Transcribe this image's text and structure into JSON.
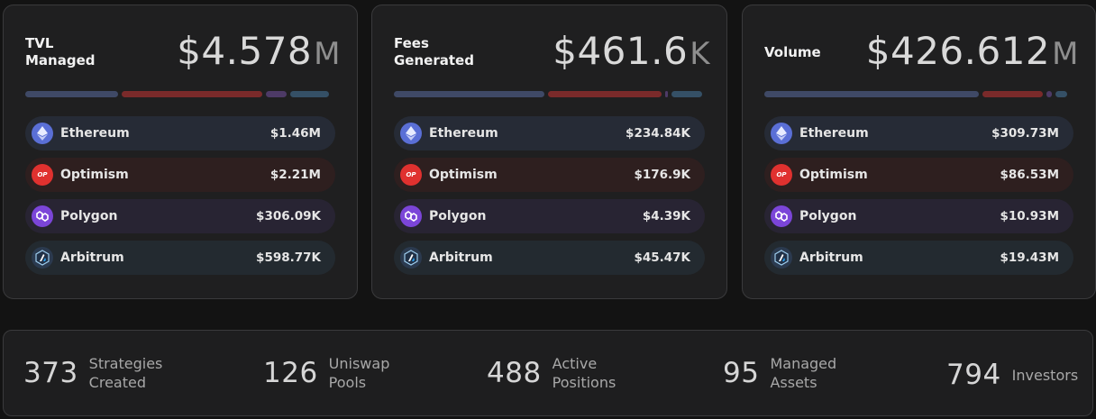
{
  "cards": [
    {
      "title": "TVL\nManaged",
      "value": "$4.578",
      "unit": "M",
      "bar": [
        {
          "color": "#3f4966",
          "share": 0.31
        },
        {
          "color": "#7a2a2a",
          "share": 0.47
        },
        {
          "color": "#4d3a66",
          "share": 0.07
        },
        {
          "color": "#355066",
          "share": 0.13
        }
      ],
      "rows": [
        {
          "chain": "Ethereum",
          "value": "$1.46M"
        },
        {
          "chain": "Optimism",
          "value": "$2.21M"
        },
        {
          "chain": "Polygon",
          "value": "$306.09K"
        },
        {
          "chain": "Arbitrum",
          "value": "$598.77K"
        }
      ]
    },
    {
      "title": "Fees\nGenerated",
      "value": "$461.6",
      "unit": "K",
      "bar": [
        {
          "color": "#3f4966",
          "share": 0.5
        },
        {
          "color": "#7a2a2a",
          "share": 0.38
        },
        {
          "color": "#4d3a66",
          "share": 0.01
        },
        {
          "color": "#355066",
          "share": 0.1
        }
      ],
      "rows": [
        {
          "chain": "Ethereum",
          "value": "$234.84K"
        },
        {
          "chain": "Optimism",
          "value": "$176.9K"
        },
        {
          "chain": "Polygon",
          "value": "$4.39K"
        },
        {
          "chain": "Arbitrum",
          "value": "$45.47K"
        }
      ]
    },
    {
      "title": "Volume",
      "value": "$426.612",
      "unit": "M",
      "bar": [
        {
          "color": "#3f4966",
          "share": 0.72
        },
        {
          "color": "#7a2a2a",
          "share": 0.2
        },
        {
          "color": "#4d3a66",
          "share": 0.02
        },
        {
          "color": "#355066",
          "share": 0.04
        }
      ],
      "rows": [
        {
          "chain": "Ethereum",
          "value": "$309.73M"
        },
        {
          "chain": "Optimism",
          "value": "$86.53M"
        },
        {
          "chain": "Polygon",
          "value": "$10.93M"
        },
        {
          "chain": "Arbitrum",
          "value": "$19.43M"
        }
      ]
    }
  ],
  "icons": {
    "ethereum": "ethereum-icon",
    "optimism": "optimism-icon",
    "optimism_text": "OP",
    "polygon": "polygon-icon",
    "arbitrum": "arbitrum-icon"
  },
  "stats": [
    {
      "value": "373",
      "label": "Strategies\nCreated"
    },
    {
      "value": "126",
      "label": "Uniswap\nPools"
    },
    {
      "value": "488",
      "label": "Active\nPositions"
    },
    {
      "value": "95",
      "label": "Managed\nAssets"
    },
    {
      "value": "794",
      "label": "Investors"
    }
  ]
}
